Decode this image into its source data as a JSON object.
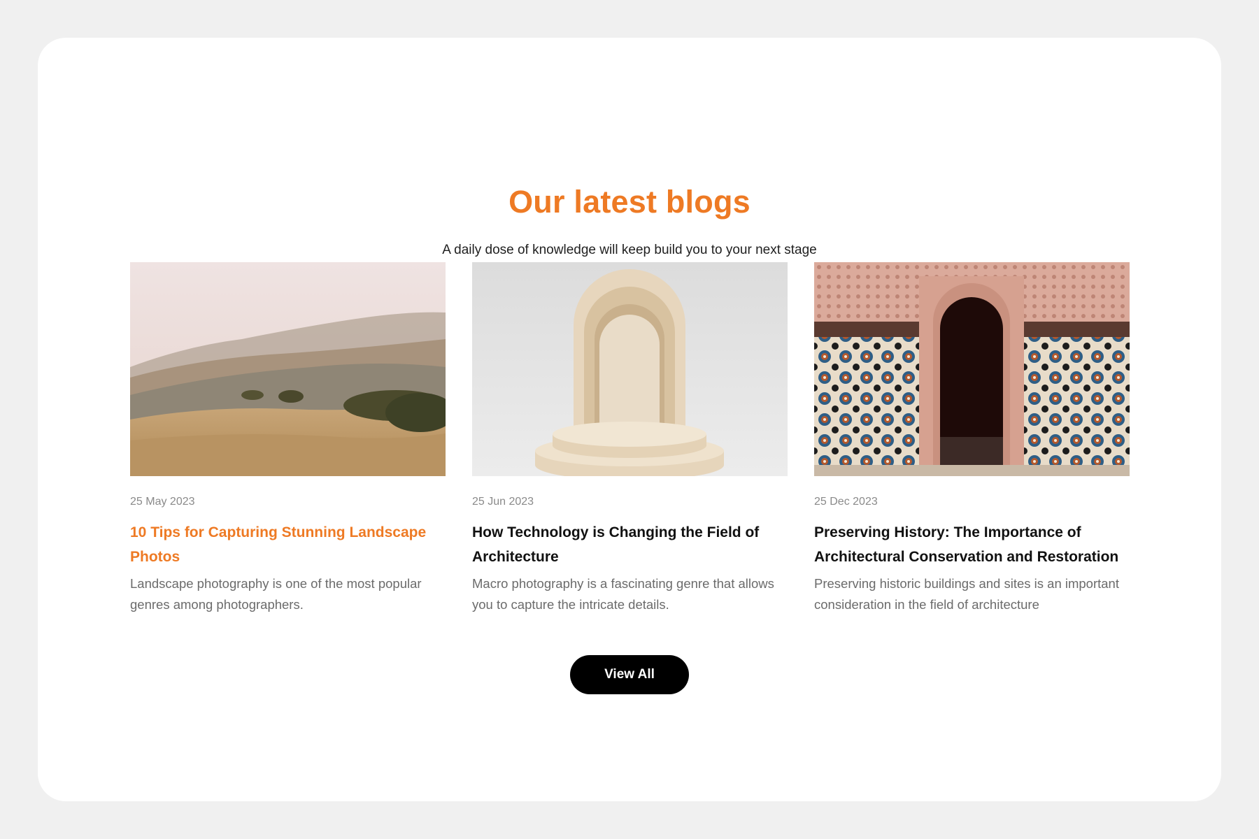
{
  "section": {
    "title": "Our latest blogs",
    "subtitle": "A daily dose of knowledge will keep build you to your next stage"
  },
  "posts": [
    {
      "date": "25 May 2023",
      "title": "10 Tips for Capturing Stunning Landscape Photos",
      "excerpt": "Landscape photography is one of the most popular genres among photographers.",
      "image": "rolling-hills-landscape-photo",
      "highlighted": true
    },
    {
      "date": "25 Jun 2023",
      "title": "How Technology is Changing the Field of Architecture",
      "excerpt": "Macro photography is a fascinating genre that allows you to capture the intricate details.",
      "image": "arch-and-podium-render",
      "highlighted": false
    },
    {
      "date": "25 Dec 2023",
      "title": "Preserving History: The Importance of Architectural Conservation and Restoration",
      "excerpt": "Preserving historic buildings and sites is an important consideration in the field of architecture",
      "image": "moorish-tiled-doorway-photo",
      "highlighted": false
    }
  ],
  "actions": {
    "view_all_label": "View All"
  },
  "colors": {
    "accent": "#ee7a24",
    "button_bg": "#000000",
    "page_bg": "#f0f0f0"
  }
}
